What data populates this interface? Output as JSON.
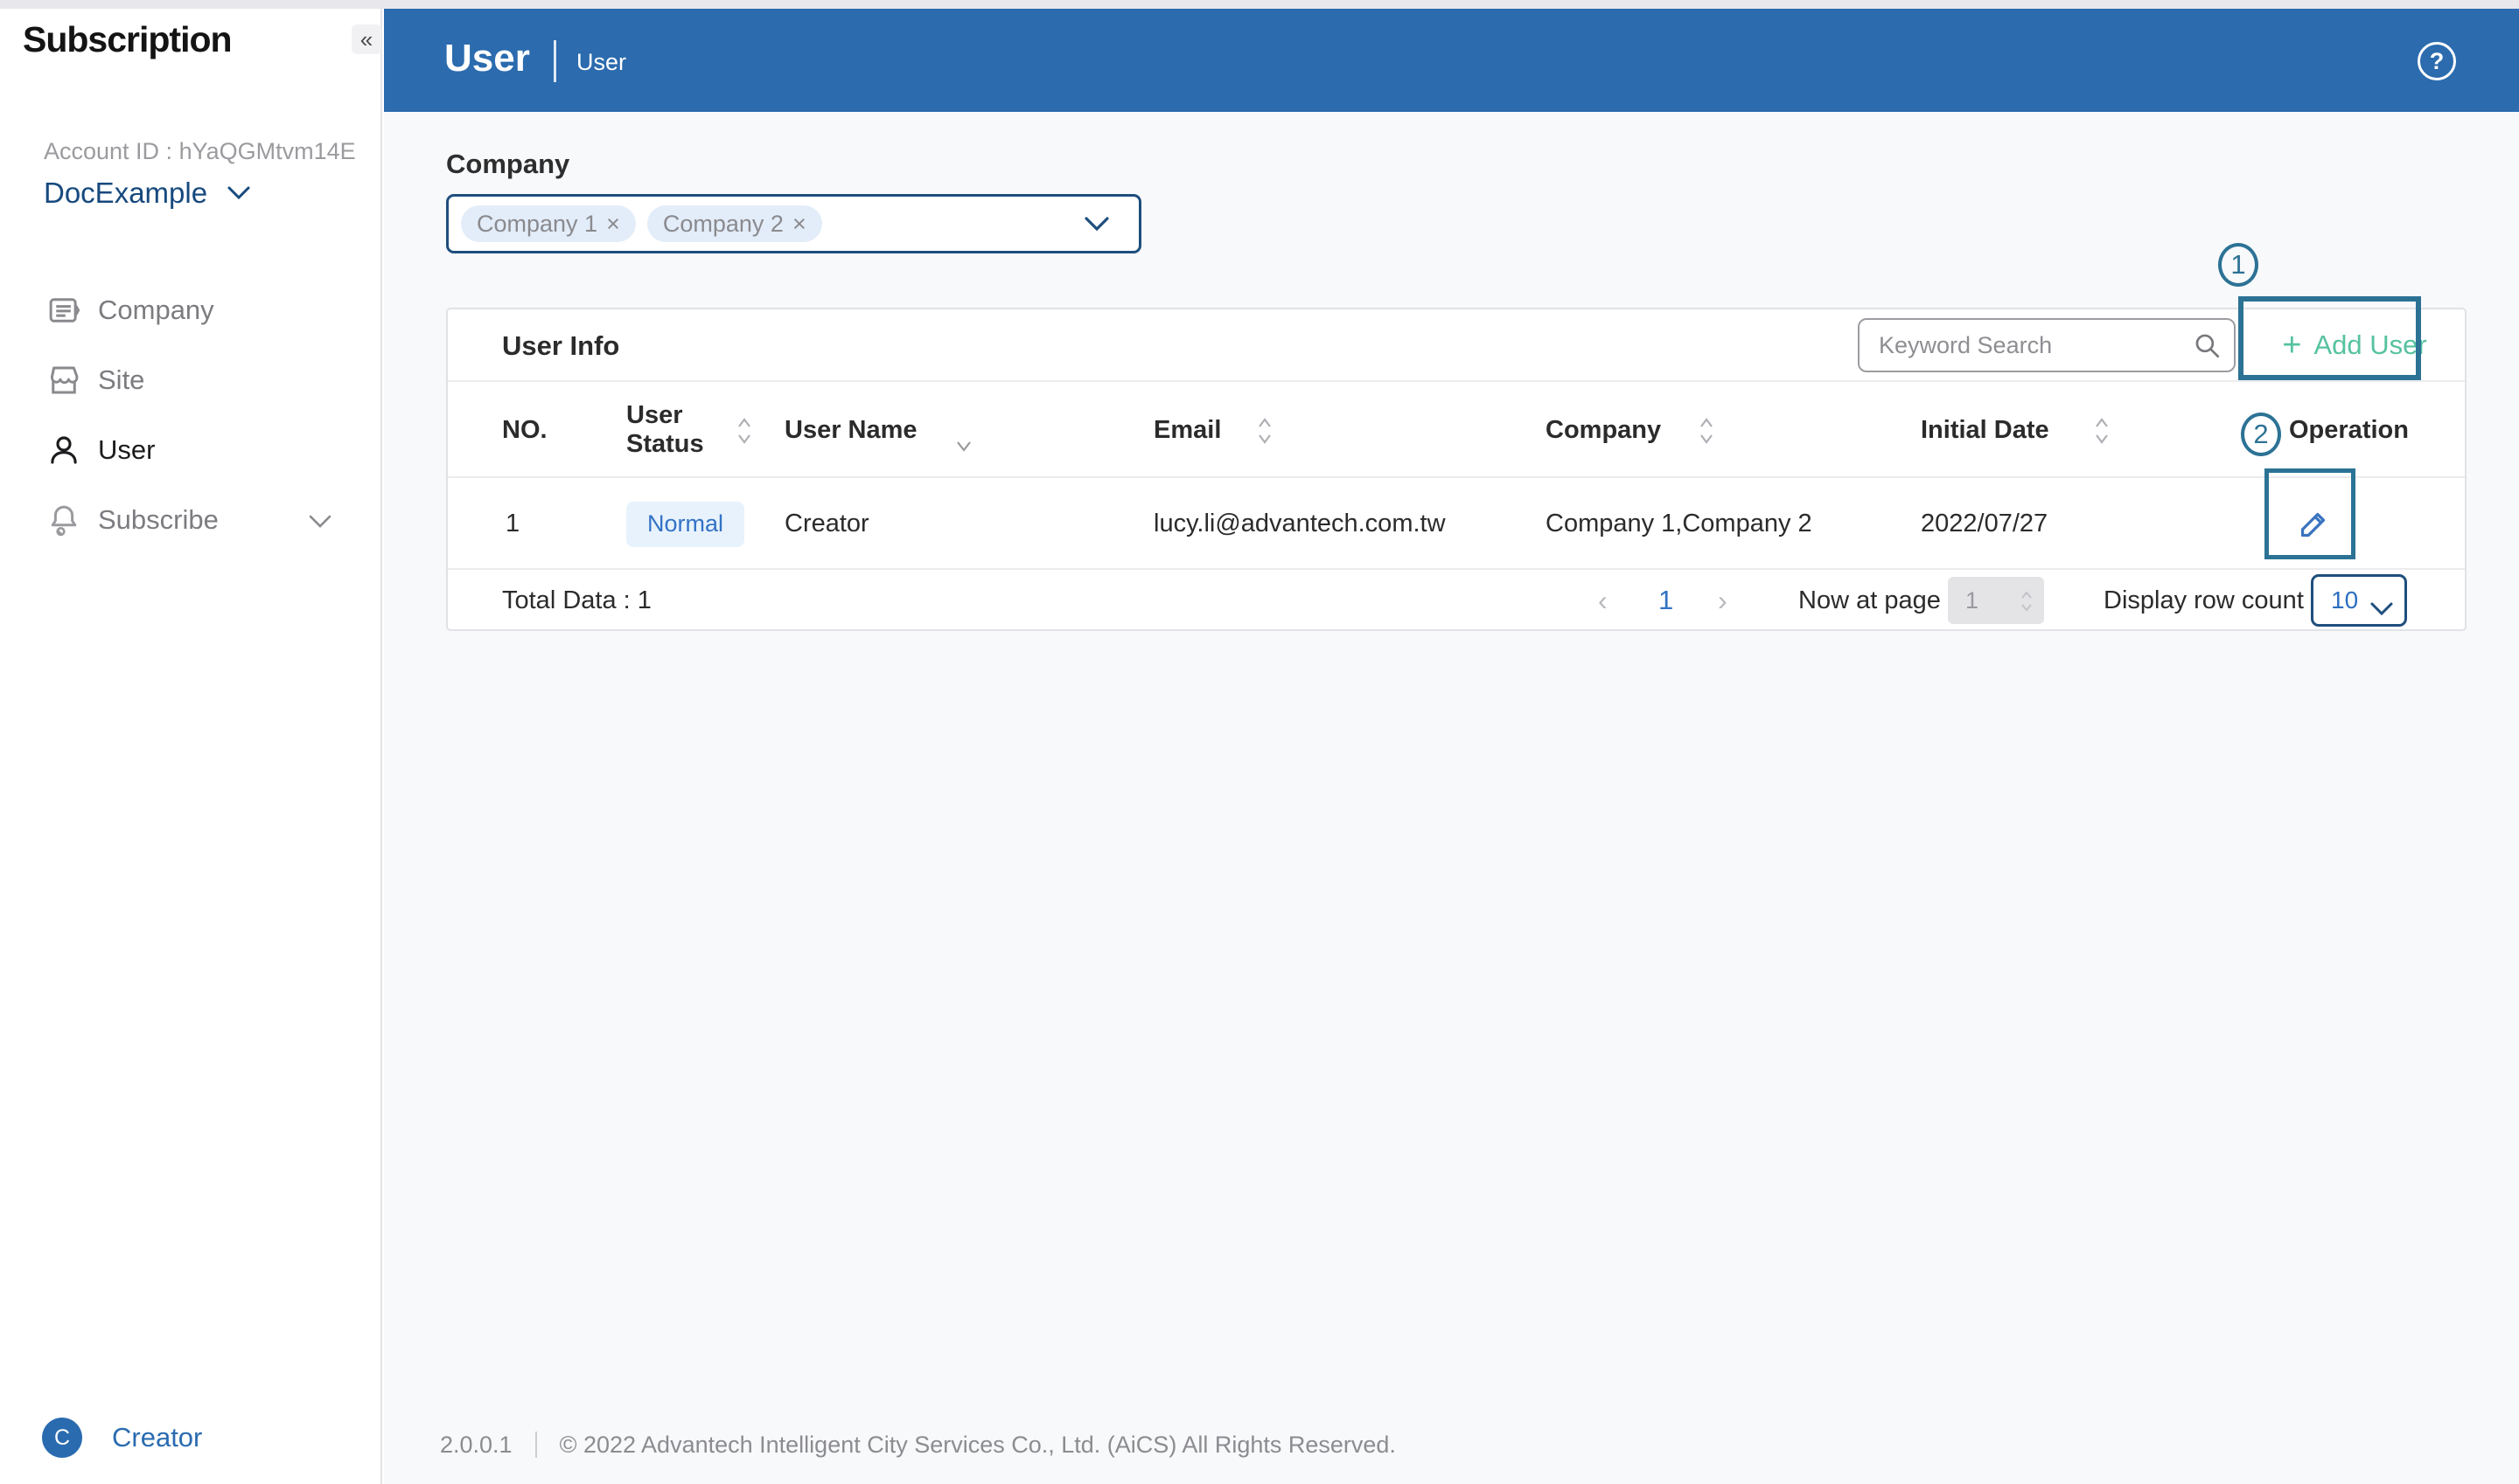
{
  "icons": {
    "collapse": "«",
    "help": "?",
    "plus": "+",
    "remove": "×",
    "prev": "‹",
    "next": "›"
  },
  "sidebar": {
    "logo": "Subscription",
    "account_id": "Account ID : hYaQGMtvm14E",
    "account_name": "DocExample",
    "items": [
      {
        "label": "Company"
      },
      {
        "label": "Site"
      },
      {
        "label": "User"
      },
      {
        "label": "Subscribe"
      }
    ],
    "current_user": "Creator",
    "avatar_initial": "C"
  },
  "header": {
    "title": "User",
    "breadcrumb": "User"
  },
  "filter": {
    "label": "Company",
    "chips": [
      {
        "label": "Company 1"
      },
      {
        "label": "Company 2"
      }
    ]
  },
  "card": {
    "title": "User Info",
    "search_placeholder": "Keyword Search",
    "add_user_label": "Add User",
    "table": {
      "columns": [
        {
          "label": "NO."
        },
        {
          "label": "User Status"
        },
        {
          "label": "User Name"
        },
        {
          "label": "Email"
        },
        {
          "label": "Company"
        },
        {
          "label": "Initial Date"
        },
        {
          "label": "Operation"
        }
      ],
      "rows": [
        {
          "no": "1",
          "status": "Normal",
          "name": "Creator",
          "email": "lucy.li@advantech.com.tw",
          "company": "Company 1,Company 2",
          "initial_date": "2022/07/27"
        }
      ]
    },
    "pagination": {
      "total": "Total Data : 1",
      "page": "1",
      "now_at_page": "Now at page",
      "page_input": "1",
      "display_row_count": "Display row count",
      "row_count": "10"
    }
  },
  "annotations": [
    {
      "number": "1"
    },
    {
      "number": "2"
    }
  ],
  "footer": {
    "version": "2.0.0.1",
    "copyright": "© 2022 Advantech Intelligent City Services Co., Ltd. (AiCS) All Rights Reserved."
  },
  "colors": {
    "header_blue": "#2b6bae",
    "accent_teal": "#56c2a0",
    "annotation_teal": "#2c7295",
    "navy_border": "#1e4e7d",
    "badge_blue": "#3273c5"
  }
}
